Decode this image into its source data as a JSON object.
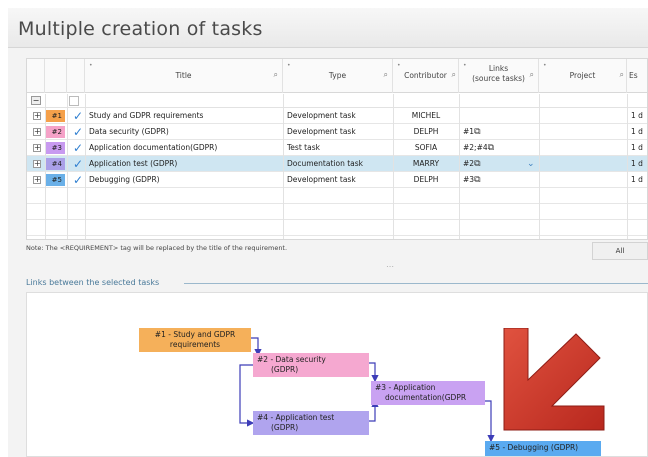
{
  "app": {
    "title": "Multiple creation of tasks"
  },
  "grid": {
    "columns": [
      {
        "label": "Title"
      },
      {
        "label": "Type"
      },
      {
        "label": "Contributor"
      },
      {
        "label_line1": "Links",
        "label_line2": "(source tasks)"
      },
      {
        "label": "Project"
      },
      {
        "label": "Es"
      }
    ],
    "rows": [
      {
        "num": "#1",
        "color": "#f5a04a",
        "title": "Study and GDPR requirements",
        "type": "Development task",
        "contributor": "MICHEL",
        "links": "",
        "est": "1 d",
        "selected": false
      },
      {
        "num": "#2",
        "color": "#f5a2c8",
        "title": "Data security (GDPR)",
        "type": "Development task",
        "contributor": "DELPH",
        "links": "#1",
        "est": "1 d",
        "selected": false
      },
      {
        "num": "#3",
        "color": "#c89af0",
        "title": "Application documentation(GDPR)",
        "type": "Test task",
        "contributor": "SOFIA",
        "links": "#2;#4",
        "est": "1 d",
        "selected": false
      },
      {
        "num": "#4",
        "color": "#aaa0e8",
        "title": "Application test (GDPR)",
        "type": "Documentation task",
        "contributor": "MARRY",
        "links": "#2",
        "est": "1 d",
        "selected": true
      },
      {
        "num": "#5",
        "color": "#6ab0e8",
        "title": "Debugging (GDPR)",
        "type": "Development task",
        "contributor": "DELPH",
        "links": "#3",
        "est": "1 d",
        "selected": false
      }
    ]
  },
  "note": "Note: The <REQUIREMENT> tag will be replaced by the title of the requirement.",
  "all_button": "All",
  "links_panel_title": "Links between the selected tasks",
  "diagram": {
    "nodes": [
      {
        "id": "n1",
        "label_line1": "#1 - Study and GDPR",
        "label_line2": "requirements",
        "color": "#f5b05a"
      },
      {
        "id": "n2",
        "label_line1": "#2 - Data security",
        "label_line2": "(GDPR)",
        "color": "#f5a8d0"
      },
      {
        "id": "n3",
        "label_line1": "#3 - Application",
        "label_line2": "documentation(GDPR",
        "color": "#c9a2f2"
      },
      {
        "id": "n4",
        "label_line1": "#4 - Application test",
        "label_line2": "(GDPR)",
        "color": "#b0a4ee"
      },
      {
        "id": "n5",
        "label_line1": "#5 - Debugging (GDPR)",
        "label_line2": "",
        "color": "#5aaaf0"
      }
    ]
  },
  "colors": {
    "accent_check": "#2f7fd0",
    "selected_row": "#cfe6f2",
    "link_arrow": "#3d3db8",
    "pointer_arrow": "#c9362a"
  },
  "icons": {
    "filter": "filter-icon",
    "link": "link-icon",
    "check": "check-icon",
    "chevron_double_down": "chevron-double-down-icon"
  }
}
